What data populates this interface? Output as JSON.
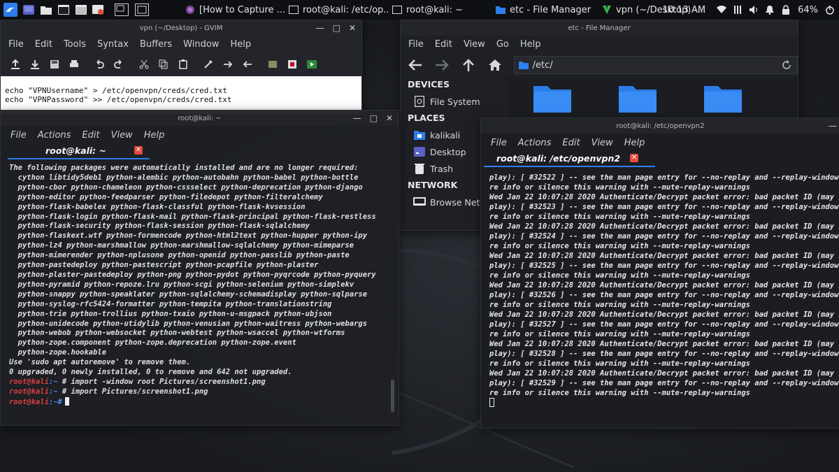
{
  "taskbar": {
    "windows": [
      {
        "name": "browser",
        "label": "[How to Capture ..."
      },
      {
        "name": "terminal-etc",
        "label": "root@kali: /etc/op..."
      },
      {
        "name": "terminal-home",
        "label": "root@kali: ~"
      },
      {
        "name": "file-manager",
        "label": "etc - File Manager"
      },
      {
        "name": "gvim",
        "label": "vpn (~/Desktop) -..."
      }
    ],
    "clock": "10:13 AM",
    "battery": "64%"
  },
  "gvim": {
    "title": "vpn (~/Desktop) - GVIM",
    "menu": [
      "File",
      "Edit",
      "Tools",
      "Syntax",
      "Buffers",
      "Window",
      "Help"
    ],
    "lines": [
      "echo \"VPNUsername\" > /etc/openvpn/creds/cred.txt",
      "echo \"VPNPassword\" >> /etc/openvpn/creds/cred.txt"
    ]
  },
  "terminal": {
    "title": "root@kali: ~",
    "menu": [
      "File",
      "Actions",
      "Edit",
      "View",
      "Help"
    ],
    "tab_label": "root@kali: ~",
    "output": [
      "The following packages were automatically installed and are no longer required:",
      "  cython libtidy5deb1 python-alembic python-autobahn python-babel python-bottle",
      "  python-cbor python-chameleon python-cssselect python-deprecation python-django",
      "  python-editor python-feedparser python-filedepot python-filteralchemy",
      "  python-flask-babelex python-flask-classful python-flask-kvsession",
      "  python-flask-login python-flask-mail python-flask-principal python-flask-restless",
      "  python-flask-security python-flask-session python-flask-sqlalchemy",
      "  python-flaskext.wtf python-formencode python-html2text python-hupper python-ipy",
      "  python-lz4 python-marshmallow python-marshmallow-sqlalchemy python-mimeparse",
      "  python-mimerender python-nplusone python-openid python-passlib python-paste",
      "  python-pastedeploy python-pastescript python-pcapfile python-plaster",
      "  python-plaster-pastedeploy python-png python-pydot python-pyqrcode python-pyquery",
      "  python-pyramid python-repoze.lru python-scgi python-selenium python-simplekv",
      "  python-snappy python-speaklater python-sqlalchemy-schemadisplay python-sqlparse",
      "  python-syslog-rfc5424-formatter python-tempita python-translationstring",
      "  python-trie python-trollius python-txaio python-u-msgpack python-ubjson",
      "  python-unidecode python-utidylib python-venusian python-waitress python-webargs",
      "  python-webob python-websocket python-webtest python-wsaccel python-wtforms",
      "  python-zope.component python-zope.deprecation python-zope.event",
      "  python-zope.hookable",
      "Use 'sudo apt autoremove' to remove them.",
      "0 upgraded, 0 newly installed, 0 to remove and 642 not upgraded."
    ],
    "prompt_user": "root@kali",
    "prompt_path": ":~#",
    "commands": [
      " # import -window root Pictures/screenshot1.png",
      " # import Pictures/screenshot1.png"
    ]
  },
  "filemanager": {
    "title": "etc - File Manager",
    "menu": [
      "File",
      "Edit",
      "View",
      "Go",
      "Help"
    ],
    "address": "/etc/",
    "sections": {
      "devices": "DEVICES",
      "places": "PLACES",
      "network": "NETWORK"
    },
    "devices": [
      "File System"
    ],
    "places": [
      "kalikali",
      "Desktop",
      "Trash"
    ],
    "network": [
      "Browse Network"
    ]
  },
  "vpn": {
    "title": "root@kali: /etc/openvpn2",
    "menu": [
      "File",
      "Actions",
      "Edit",
      "View",
      "Help"
    ],
    "tab_label": "root@kali: /etc/openvpn2",
    "output": [
      "play): [ #32522 ] -- see the man page entry for --no-replay and --replay-window for mo",
      "re info or silence this warning with --mute-replay-warnings",
      "Wed Jan 22 10:07:28 2020 Authenticate/Decrypt packet error: bad packet ID (may be a re",
      "play): [ #32523 ] -- see the man page entry for --no-replay and --replay-window for mo",
      "re info or silence this warning with --mute-replay-warnings",
      "Wed Jan 22 10:07:28 2020 Authenticate/Decrypt packet error: bad packet ID (may be a re",
      "play): [ #32524 ] -- see the man page entry for --no-replay and --replay-window for mo",
      "re info or silence this warning with --mute-replay-warnings",
      "Wed Jan 22 10:07:28 2020 Authenticate/Decrypt packet error: bad packet ID (may be a re",
      "play): [ #32525 ] -- see the man page entry for --no-replay and --replay-window for mo",
      "re info or silence this warning with --mute-replay-warnings",
      "Wed Jan 22 10:07:28 2020 Authenticate/Decrypt packet error: bad packet ID (may be a re",
      "play): [ #32526 ] -- see the man page entry for --no-replay and --replay-window for mo",
      "re info or silence this warning with --mute-replay-warnings",
      "Wed Jan 22 10:07:28 2020 Authenticate/Decrypt packet error: bad packet ID (may be a re",
      "play): [ #32527 ] -- see the man page entry for --no-replay and --replay-window for mo",
      "re info or silence this warning with --mute-replay-warnings",
      "Wed Jan 22 10:07:28 2020 Authenticate/Decrypt packet error: bad packet ID (may be a re",
      "play): [ #32528 ] -- see the man page entry for --no-replay and --replay-window for mo",
      "re info or silence this warning with --mute-replay-warnings",
      "Wed Jan 22 10:07:28 2020 Authenticate/Decrypt packet error: bad packet ID (may be a re",
      "play): [ #32529 ] -- see the man page entry for --no-replay and --replay-window for mo",
      "re info or silence this warning with --mute-replay-warnings"
    ]
  },
  "colors": {
    "accent": "#2f7ff2",
    "prompt_red": "#e0403e",
    "folder_blue": "#2d7de8"
  }
}
